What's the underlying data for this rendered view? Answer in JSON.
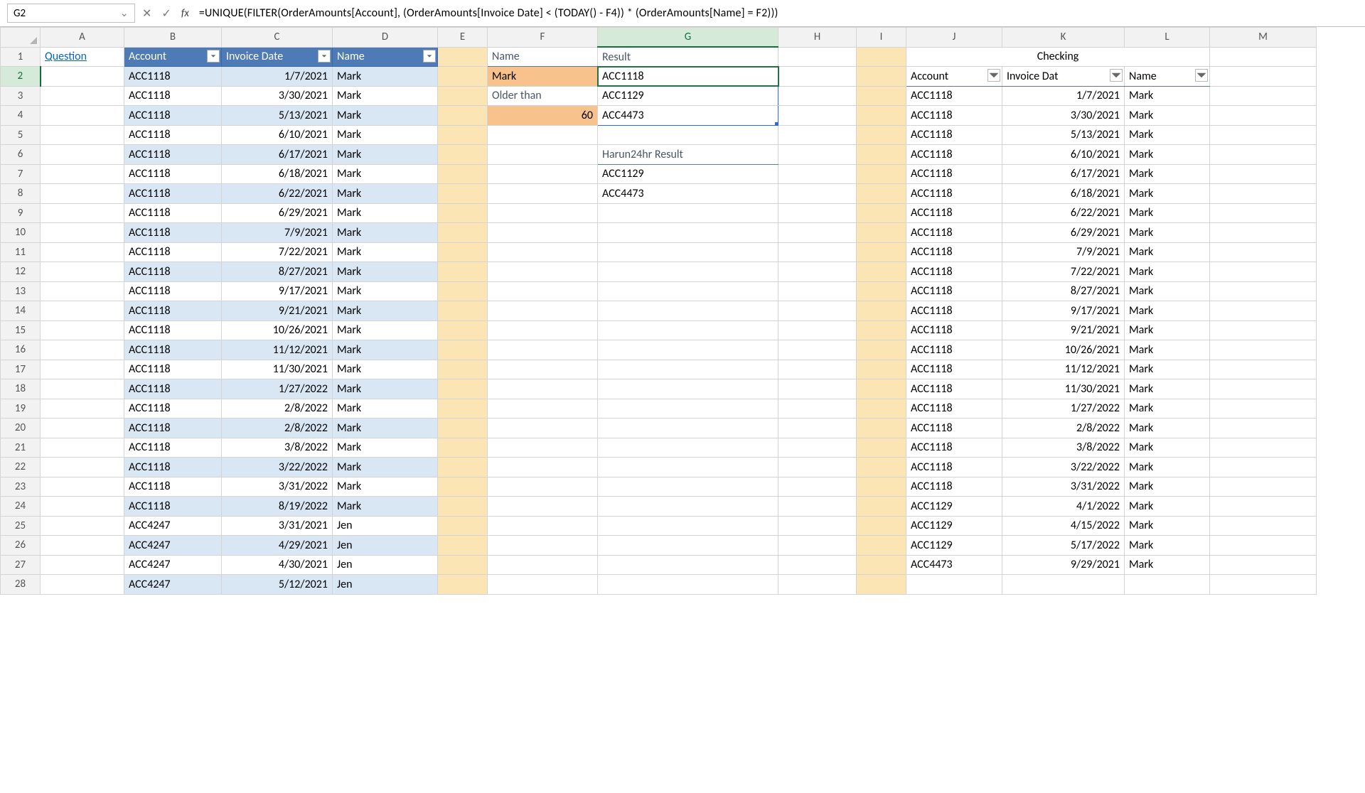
{
  "formula_bar": {
    "namebox": "G2",
    "fx": "fx",
    "formula": "=UNIQUE(FILTER(OrderAmounts[Account], (OrderAmounts[Invoice Date] < (TODAY() - F4)) * (OrderAmounts[Name] = F2)))"
  },
  "columns": [
    "A",
    "B",
    "C",
    "D",
    "E",
    "F",
    "G",
    "H",
    "I",
    "J",
    "K",
    "L",
    "M"
  ],
  "row_count": 28,
  "a1": "Question",
  "table1": {
    "headers": [
      "Account",
      "Invoice Date",
      "Name"
    ],
    "rows": [
      [
        "ACC1118",
        "1/7/2021",
        "Mark"
      ],
      [
        "ACC1118",
        "3/30/2021",
        "Mark"
      ],
      [
        "ACC1118",
        "5/13/2021",
        "Mark"
      ],
      [
        "ACC1118",
        "6/10/2021",
        "Mark"
      ],
      [
        "ACC1118",
        "6/17/2021",
        "Mark"
      ],
      [
        "ACC1118",
        "6/18/2021",
        "Mark"
      ],
      [
        "ACC1118",
        "6/22/2021",
        "Mark"
      ],
      [
        "ACC1118",
        "6/29/2021",
        "Mark"
      ],
      [
        "ACC1118",
        "7/9/2021",
        "Mark"
      ],
      [
        "ACC1118",
        "7/22/2021",
        "Mark"
      ],
      [
        "ACC1118",
        "8/27/2021",
        "Mark"
      ],
      [
        "ACC1118",
        "9/17/2021",
        "Mark"
      ],
      [
        "ACC1118",
        "9/21/2021",
        "Mark"
      ],
      [
        "ACC1118",
        "10/26/2021",
        "Mark"
      ],
      [
        "ACC1118",
        "11/12/2021",
        "Mark"
      ],
      [
        "ACC1118",
        "11/30/2021",
        "Mark"
      ],
      [
        "ACC1118",
        "1/27/2022",
        "Mark"
      ],
      [
        "ACC1118",
        "2/8/2022",
        "Mark"
      ],
      [
        "ACC1118",
        "2/8/2022",
        "Mark"
      ],
      [
        "ACC1118",
        "3/8/2022",
        "Mark"
      ],
      [
        "ACC1118",
        "3/22/2022",
        "Mark"
      ],
      [
        "ACC1118",
        "3/31/2022",
        "Mark"
      ],
      [
        "ACC1118",
        "8/19/2022",
        "Mark"
      ],
      [
        "ACC4247",
        "3/31/2021",
        "Jen"
      ],
      [
        "ACC4247",
        "4/29/2021",
        "Jen"
      ],
      [
        "ACC4247",
        "4/30/2021",
        "Jen"
      ],
      [
        "ACC4247",
        "5/12/2021",
        "Jen"
      ]
    ]
  },
  "params": {
    "name_label": "Name",
    "name_value": "Mark",
    "older_label": "Older than",
    "older_value": "60",
    "result_label": "Result",
    "result": [
      "ACC1118",
      "ACC1129",
      "ACC4473"
    ],
    "harun_label": "Harun24hr Result",
    "harun": [
      "ACC1129",
      "ACC4473"
    ]
  },
  "checking": {
    "title": "Checking",
    "headers": [
      "Account",
      "Invoice Date",
      "Name"
    ],
    "rows": [
      [
        "ACC1118",
        "1/7/2021",
        "Mark"
      ],
      [
        "ACC1118",
        "3/30/2021",
        "Mark"
      ],
      [
        "ACC1118",
        "5/13/2021",
        "Mark"
      ],
      [
        "ACC1118",
        "6/10/2021",
        "Mark"
      ],
      [
        "ACC1118",
        "6/17/2021",
        "Mark"
      ],
      [
        "ACC1118",
        "6/18/2021",
        "Mark"
      ],
      [
        "ACC1118",
        "6/22/2021",
        "Mark"
      ],
      [
        "ACC1118",
        "6/29/2021",
        "Mark"
      ],
      [
        "ACC1118",
        "7/9/2021",
        "Mark"
      ],
      [
        "ACC1118",
        "7/22/2021",
        "Mark"
      ],
      [
        "ACC1118",
        "8/27/2021",
        "Mark"
      ],
      [
        "ACC1118",
        "9/17/2021",
        "Mark"
      ],
      [
        "ACC1118",
        "9/21/2021",
        "Mark"
      ],
      [
        "ACC1118",
        "10/26/2021",
        "Mark"
      ],
      [
        "ACC1118",
        "11/12/2021",
        "Mark"
      ],
      [
        "ACC1118",
        "11/30/2021",
        "Mark"
      ],
      [
        "ACC1118",
        "1/27/2022",
        "Mark"
      ],
      [
        "ACC1118",
        "2/8/2022",
        "Mark"
      ],
      [
        "ACC1118",
        "3/8/2022",
        "Mark"
      ],
      [
        "ACC1118",
        "3/22/2022",
        "Mark"
      ],
      [
        "ACC1118",
        "3/31/2022",
        "Mark"
      ],
      [
        "ACC1129",
        "4/1/2022",
        "Mark"
      ],
      [
        "ACC1129",
        "4/15/2022",
        "Mark"
      ],
      [
        "ACC1129",
        "5/17/2022",
        "Mark"
      ],
      [
        "ACC4473",
        "9/29/2021",
        "Mark"
      ]
    ]
  },
  "colors": {
    "blue_header": "#4e7bb5",
    "alt_row": "#d9e7f5",
    "orange": "#f8c28d",
    "pale_orange": "#fbe5b5"
  }
}
